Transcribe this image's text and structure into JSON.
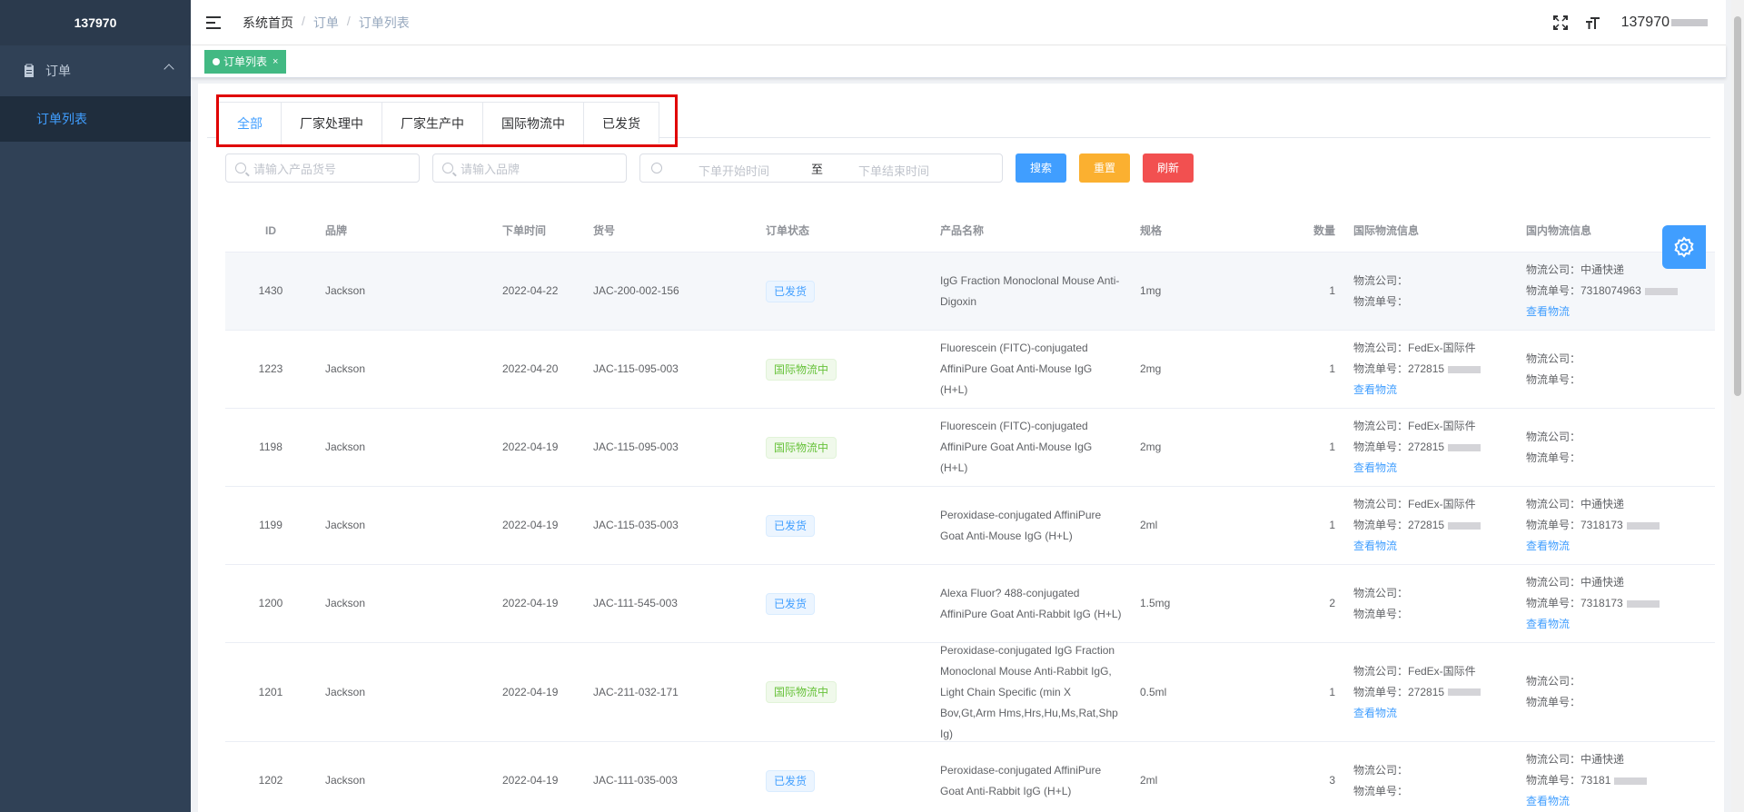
{
  "sidebar": {
    "logo": "137970",
    "menu": {
      "label": "订单",
      "sub_item": "订单列表"
    }
  },
  "navbar": {
    "breadcrumb": [
      "系统首页",
      "订单",
      "订单列表"
    ],
    "username": "137970"
  },
  "tagsview": {
    "active_tag": "订单列表",
    "close": "×"
  },
  "tabs": [
    "全部",
    "厂家处理中",
    "厂家生产中",
    "国际物流中",
    "已发货"
  ],
  "search": {
    "sku_placeholder": "请输入产品货号",
    "brand_placeholder": "请输入品牌",
    "start_placeholder": "下单开始时间",
    "range_separator": "至",
    "end_placeholder": "下单结束时间",
    "search_btn": "搜索",
    "reset_btn": "重置",
    "refresh_btn": "刷新"
  },
  "table": {
    "headers": [
      "ID",
      "品牌",
      "下单时间",
      "货号",
      "订单状态",
      "产品名称",
      "规格",
      "数量",
      "国际物流信息",
      "国内物流信息"
    ],
    "rows": [
      {
        "id": "1430",
        "brand": "Jackson",
        "time": "2022-04-22",
        "sku": "JAC-200-002-156",
        "status": "已发货",
        "status_type": "shipped",
        "name": "IgG Fraction Monoclonal Mouse Anti-Digoxin",
        "spec": "1mg",
        "qty": "1",
        "intl_company": "物流公司：",
        "intl_no": "物流单号：",
        "intl_link": "",
        "dom_company": "物流公司：中通快递",
        "dom_no": "物流单号：7318074963",
        "dom_link": "查看物流"
      },
      {
        "id": "1223",
        "brand": "Jackson",
        "time": "2022-04-20",
        "sku": "JAC-115-095-003",
        "status": "国际物流中",
        "status_type": "intl",
        "name": "Fluorescein (FITC)-conjugated AffiniPure Goat Anti-Mouse IgG (H+L)",
        "spec": "2mg",
        "qty": "1",
        "intl_company": "物流公司：FedEx-国际件",
        "intl_no": "物流单号：272815",
        "intl_link": "查看物流",
        "dom_company": "物流公司：",
        "dom_no": "物流单号：",
        "dom_link": ""
      },
      {
        "id": "1198",
        "brand": "Jackson",
        "time": "2022-04-19",
        "sku": "JAC-115-095-003",
        "status": "国际物流中",
        "status_type": "intl",
        "name": "Fluorescein (FITC)-conjugated AffiniPure Goat Anti-Mouse IgG (H+L)",
        "spec": "2mg",
        "qty": "1",
        "intl_company": "物流公司：FedEx-国际件",
        "intl_no": "物流单号：272815",
        "intl_link": "查看物流",
        "dom_company": "物流公司：",
        "dom_no": "物流单号：",
        "dom_link": ""
      },
      {
        "id": "1199",
        "brand": "Jackson",
        "time": "2022-04-19",
        "sku": "JAC-115-035-003",
        "status": "已发货",
        "status_type": "shipped",
        "name": "Peroxidase-conjugated AffiniPure Goat Anti-Mouse IgG (H+L)",
        "spec": "2ml",
        "qty": "1",
        "intl_company": "物流公司：FedEx-国际件",
        "intl_no": "物流单号：272815",
        "intl_link": "查看物流",
        "dom_company": "物流公司：中通快递",
        "dom_no": "物流单号：7318173",
        "dom_link": "查看物流"
      },
      {
        "id": "1200",
        "brand": "Jackson",
        "time": "2022-04-19",
        "sku": "JAC-111-545-003",
        "status": "已发货",
        "status_type": "shipped",
        "name": "Alexa Fluor? 488-conjugated AffiniPure Goat Anti-Rabbit IgG (H+L)",
        "spec": "1.5mg",
        "qty": "2",
        "intl_company": "物流公司：",
        "intl_no": "物流单号：",
        "intl_link": "",
        "dom_company": "物流公司：中通快递",
        "dom_no": "物流单号：7318173",
        "dom_link": "查看物流"
      },
      {
        "id": "1201",
        "brand": "Jackson",
        "time": "2022-04-19",
        "sku": "JAC-211-032-171",
        "status": "国际物流中",
        "status_type": "intl",
        "name": "Peroxidase-conjugated IgG Fraction Monoclonal Mouse Anti-Rabbit IgG, Light Chain Specific (min X Bov,Gt,Arm Hms,Hrs,Hu,Ms,Rat,Shp Ig)",
        "spec": "0.5ml",
        "qty": "1",
        "intl_company": "物流公司：FedEx-国际件",
        "intl_no": "物流单号：272815",
        "intl_link": "查看物流",
        "dom_company": "物流公司：",
        "dom_no": "物流单号：",
        "dom_link": ""
      },
      {
        "id": "1202",
        "brand": "Jackson",
        "time": "2022-04-19",
        "sku": "JAC-111-035-003",
        "status": "已发货",
        "status_type": "shipped",
        "name": "Peroxidase-conjugated AffiniPure Goat Anti-Rabbit IgG (H+L)",
        "spec": "2ml",
        "qty": "3",
        "intl_company": "物流公司：",
        "intl_no": "物流单号：",
        "intl_link": "",
        "dom_company": "物流公司：中通快递",
        "dom_no": "物流单号：73181",
        "dom_link": "查看物流"
      }
    ]
  },
  "colors": {
    "sidebar_bg": "#304156",
    "primary": "#409eff",
    "warning": "#fbb030",
    "danger": "#f25050",
    "success": "#42b983",
    "highlight": "#e00000"
  }
}
